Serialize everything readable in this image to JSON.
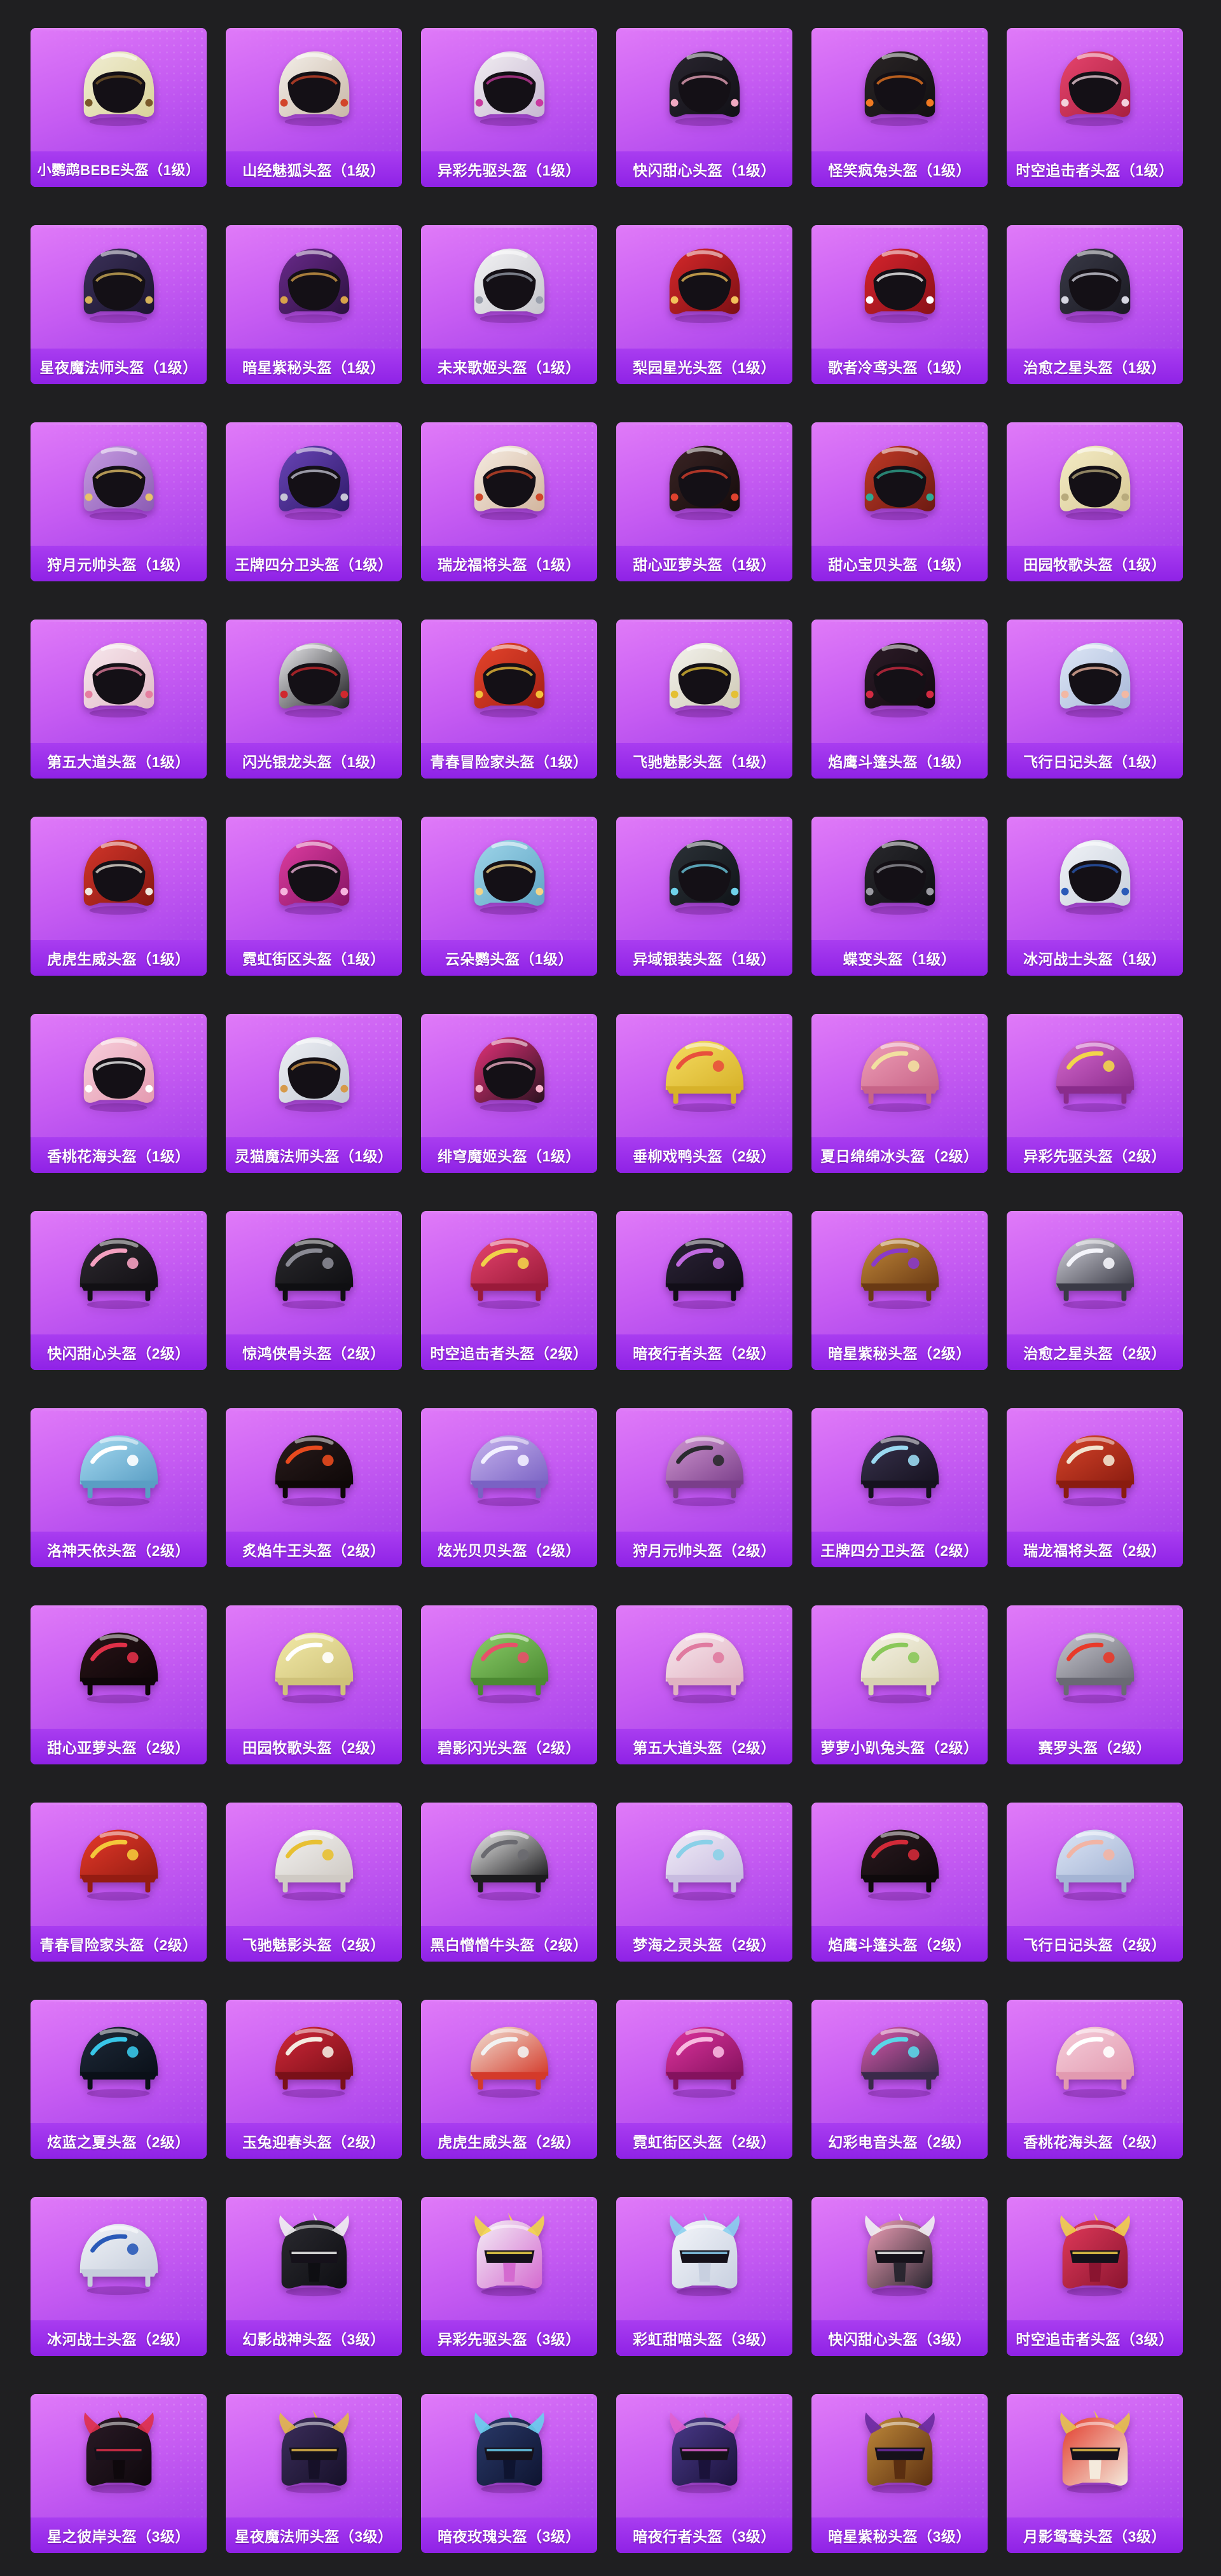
{
  "items": [
    {
      "label": "小鹦鹉BEBE头盔（1级）",
      "shape": "open",
      "c1": "#f1eed4",
      "c2": "#d9d39a",
      "accent": "#7a5a2a"
    },
    {
      "label": "山经魅狐头盔（1级）",
      "shape": "open",
      "c1": "#f4f0ea",
      "c2": "#c9b8a8",
      "accent": "#d2452a"
    },
    {
      "label": "异彩先驱头盔（1级）",
      "shape": "open",
      "c1": "#f2eef2",
      "c2": "#c7b8d2",
      "accent": "#c93aa0"
    },
    {
      "label": "快闪甜心头盔（1级）",
      "shape": "open",
      "c1": "#2a2630",
      "c2": "#111016",
      "accent": "#f0a8c0"
    },
    {
      "label": "怪笑疯兔头盔（1级）",
      "shape": "open",
      "c1": "#2a2526",
      "c2": "#121012",
      "accent": "#f07a22"
    },
    {
      "label": "时空追击者头盔（1级）",
      "shape": "open",
      "c1": "#e8456f",
      "c2": "#a8203f",
      "accent": "#f3d2dc"
    },
    {
      "label": "星夜魔法师头盔（1级）",
      "shape": "open",
      "c1": "#3b3159",
      "c2": "#1c1530",
      "accent": "#d4b15a"
    },
    {
      "label": "暗星紫秘头盔（1级）",
      "shape": "open",
      "c1": "#6a2a8c",
      "c2": "#2c1240",
      "accent": "#d8a24a"
    },
    {
      "label": "未来歌姬头盔（1级）",
      "shape": "open",
      "c1": "#f3f3f5",
      "c2": "#c6c6cc",
      "accent": "#9aa0ad"
    },
    {
      "label": "梨园星光头盔（1级）",
      "shape": "open",
      "c1": "#d6282a",
      "c2": "#7c1014",
      "accent": "#f2c15a"
    },
    {
      "label": "歌者冷鸢头盔（1级）",
      "shape": "open",
      "c1": "#d8242d",
      "c2": "#8a1118",
      "accent": "#ffffff"
    },
    {
      "label": "治愈之星头盔（1级）",
      "shape": "open",
      "c1": "#3a3a48",
      "c2": "#1a1a22",
      "accent": "#d6d6e2"
    },
    {
      "label": "狩月元帅头盔（1级）",
      "shape": "open",
      "c1": "#c79de2",
      "c2": "#8b5bb4",
      "accent": "#e7c36a"
    },
    {
      "label": "王牌四分卫头盔（1级）",
      "shape": "open",
      "c1": "#6a45b8",
      "c2": "#2f1b6a",
      "accent": "#c6c6d6"
    },
    {
      "label": "瑞龙福将头盔（1级）",
      "shape": "open",
      "c1": "#f6ede2",
      "c2": "#d2b59e",
      "accent": "#d0472a"
    },
    {
      "label": "甜心亚萝头盔（1级）",
      "shape": "open",
      "c1": "#3a2424",
      "c2": "#160c0c",
      "accent": "#e0422e"
    },
    {
      "label": "甜心宝贝头盔（1级）",
      "shape": "open",
      "c1": "#c23a26",
      "c2": "#6c1a12",
      "accent": "#2fa892"
    },
    {
      "label": "田园牧歌头盔（1级）",
      "shape": "open",
      "c1": "#f5edc6",
      "c2": "#d7c896",
      "accent": "#b8aa7c"
    },
    {
      "label": "第五大道头盔（1级）",
      "shape": "open",
      "c1": "#f8e9ee",
      "c2": "#e0b9c6",
      "accent": "#e57fa0"
    },
    {
      "label": "闪光银龙头盔（1级）",
      "shape": "open",
      "c1": "#f1f1f4",
      "c2": "#1e1e22",
      "accent": "#d0282e"
    },
    {
      "label": "青春冒险家头盔（1级）",
      "shape": "open",
      "c1": "#e7452c",
      "c2": "#a42014",
      "accent": "#f3c23a"
    },
    {
      "label": "飞驰魅影头盔（1级）",
      "shape": "open",
      "c1": "#f4f3ee",
      "c2": "#cfcab6",
      "accent": "#e4c034"
    },
    {
      "label": "焰鹰斗篷头盔（1级）",
      "shape": "open",
      "c1": "#2d1c28",
      "c2": "#120a10",
      "accent": "#d32a42"
    },
    {
      "label": "飞行日记头盔（1级）",
      "shape": "open",
      "c1": "#dfe8f7",
      "c2": "#a8b8d8",
      "accent": "#f2b8a4"
    },
    {
      "label": "虎虎生威头盔（1级）",
      "shape": "open",
      "c1": "#d4362a",
      "c2": "#861811",
      "accent": "#f0e8de"
    },
    {
      "label": "霓虹街区头盔（1级）",
      "shape": "open",
      "c1": "#e03ea2",
      "c2": "#861464",
      "accent": "#f6b4de"
    },
    {
      "label": "云朵鹦头盔（1级）",
      "shape": "open",
      "c1": "#9fd6ea",
      "c2": "#5fa4c4",
      "accent": "#f3d488"
    },
    {
      "label": "异域银装头盔（1级）",
      "shape": "open",
      "c1": "#2c3238",
      "c2": "#101418",
      "accent": "#6fd2ea"
    },
    {
      "label": "蝶变头盔（1级）",
      "shape": "open",
      "c1": "#2a2a2e",
      "c2": "#0e0e12",
      "accent": "#9a9aa2"
    },
    {
      "label": "冰河战士头盔（1级）",
      "shape": "open",
      "c1": "#f1f3f7",
      "c2": "#c8d0dc",
      "accent": "#2a5ab8"
    },
    {
      "label": "香桃花海头盔（1级）",
      "shape": "open",
      "c1": "#f8d0dc",
      "c2": "#e49ab0",
      "accent": "#ffffff"
    },
    {
      "label": "灵猫魔法师头盔（1级）",
      "shape": "open",
      "c1": "#eef0f4",
      "c2": "#c2c8d4",
      "accent": "#d69a4a"
    },
    {
      "label": "绯穹魔姬头盔（1级）",
      "shape": "open",
      "c1": "#e6327a",
      "c2": "#2a1220",
      "accent": "#f7b4cc"
    },
    {
      "label": "垂柳戏鸭头盔（2级）",
      "shape": "cap",
      "c1": "#f6dd62",
      "c2": "#d7b22a",
      "accent": "#e8503c"
    },
    {
      "label": "夏日绵绵冰头盔（2级）",
      "shape": "cap",
      "c1": "#f0a0b8",
      "c2": "#c76488",
      "accent": "#f2e0a0"
    },
    {
      "label": "异彩先驱头盔（2级）",
      "shape": "cap",
      "c1": "#d86ad0",
      "c2": "#8a2c8c",
      "accent": "#f2d64a"
    },
    {
      "label": "快闪甜心头盔（2级）",
      "shape": "cap",
      "c1": "#2e2a30",
      "c2": "#121014",
      "accent": "#f4a0c0"
    },
    {
      "label": "惊鸿侠骨头盔（2级）",
      "shape": "cap",
      "c1": "#2b2a2e",
      "c2": "#0f0f12",
      "accent": "#8a8a94"
    },
    {
      "label": "时空追击者头盔（2级）",
      "shape": "cap",
      "c1": "#e8456f",
      "c2": "#9a1a3a",
      "accent": "#f2d04a"
    },
    {
      "label": "暗夜行者头盔（2级）",
      "shape": "cap",
      "c1": "#2c2438",
      "c2": "#120e18",
      "accent": "#c06ae0"
    },
    {
      "label": "暗星紫秘头盔（2级）",
      "shape": "cap",
      "c1": "#c48a3a",
      "c2": "#6a3a14",
      "accent": "#8a3ac8"
    },
    {
      "label": "治愈之星头盔（2级）",
      "shape": "cap",
      "c1": "#d6d6de",
      "c2": "#3a3a46",
      "accent": "#f4f4fa"
    },
    {
      "label": "洛神天依头盔（2级）",
      "shape": "cap",
      "c1": "#a8dcf2",
      "c2": "#5a9ec4",
      "accent": "#ffffff"
    },
    {
      "label": "炙焰牛王头盔（2级）",
      "shape": "cap",
      "c1": "#2a1c1c",
      "c2": "#0e0808",
      "accent": "#e84a1e"
    },
    {
      "label": "炫光贝贝头盔（2级）",
      "shape": "cap",
      "c1": "#c8b6ee",
      "c2": "#7a62c4",
      "accent": "#f2f0ff"
    },
    {
      "label": "狩月元帅头盔（2级）",
      "shape": "cap",
      "c1": "#d29ad2",
      "c2": "#7a3e8a",
      "accent": "#2a2a2e"
    },
    {
      "label": "王牌四分卫头盔（2级）",
      "shape": "cap",
      "c1": "#3a3450",
      "c2": "#16121f",
      "accent": "#9ad8f0"
    },
    {
      "label": "瑞龙福将头盔（2级）",
      "shape": "cap",
      "c1": "#d8452a",
      "c2": "#8a1c10",
      "accent": "#f2e4d0"
    },
    {
      "label": "甜心亚萝头盔（2级）",
      "shape": "cap",
      "c1": "#2a1418",
      "c2": "#0e0608",
      "accent": "#e03048"
    },
    {
      "label": "田园牧歌头盔（2级）",
      "shape": "cap",
      "c1": "#f2eaa8",
      "c2": "#cfc27a",
      "accent": "#ffffff"
    },
    {
      "label": "碧影闪光头盔（2级）",
      "shape": "cap",
      "c1": "#8ccf6a",
      "c2": "#4c8a32",
      "accent": "#e8506a"
    },
    {
      "label": "第五大道头盔（2级）",
      "shape": "cap",
      "c1": "#f8e8ee",
      "c2": "#e0b2c2",
      "accent": "#e07aa0"
    },
    {
      "label": "萝萝小趴兔头盔（2级）",
      "shape": "cap",
      "c1": "#f6f4e6",
      "c2": "#d8d2b2",
      "accent": "#8ac85a"
    },
    {
      "label": "赛罗头盔（2级）",
      "shape": "cap",
      "c1": "#c8c8d0",
      "c2": "#6a6a74",
      "accent": "#e83a2a"
    },
    {
      "label": "青春冒险家头盔（2级）",
      "shape": "cap",
      "c1": "#e83a2a",
      "c2": "#941c12",
      "accent": "#f4c83a"
    },
    {
      "label": "飞驰魅影头盔（2级）",
      "shape": "cap",
      "c1": "#f4f3f2",
      "c2": "#cfcac4",
      "accent": "#e8c032"
    },
    {
      "label": "黑白憎憎牛头盔（2级）",
      "shape": "cap",
      "c1": "#f2f2f2",
      "c2": "#1c1c1e",
      "accent": "#6a6a70"
    },
    {
      "label": "梦海之灵头盔（2级）",
      "shape": "cap",
      "c1": "#f2eef8",
      "c2": "#c8bce0",
      "accent": "#8ad0e8"
    },
    {
      "label": "焰鹰斗篷头盔（2级）",
      "shape": "cap",
      "c1": "#2c1a20",
      "c2": "#0f0a0c",
      "accent": "#d22a38"
    },
    {
      "label": "飞行日记头盔（2级）",
      "shape": "cap",
      "c1": "#dde6f6",
      "c2": "#a4b4d4",
      "accent": "#f2b4a4"
    },
    {
      "label": "炫蓝之夏头盔（2级）",
      "shape": "cap",
      "c1": "#1e2a3a",
      "c2": "#0a1018",
      "accent": "#38c6e8"
    },
    {
      "label": "玉兔迎春头盔（2级）",
      "shape": "cap",
      "c1": "#d4283a",
      "c2": "#7a1018",
      "accent": "#f4eae0"
    },
    {
      "label": "虎虎生威头盔（2级）",
      "shape": "cap",
      "c1": "#f2e6da",
      "c2": "#d43a2a",
      "accent": "#f2f2f2"
    },
    {
      "label": "霓虹街区头盔（2级）",
      "shape": "cap",
      "c1": "#e234a0",
      "c2": "#84125e",
      "accent": "#f8b8e0"
    },
    {
      "label": "幻彩电音头盔（2级）",
      "shape": "cap",
      "c1": "#e05ab0",
      "c2": "#3a2a4a",
      "accent": "#5ad6e8"
    },
    {
      "label": "香桃花海头盔（2级）",
      "shape": "cap",
      "c1": "#f6d0dc",
      "c2": "#e29ab0",
      "accent": "#ffffff"
    },
    {
      "label": "冰河战士头盔（2级）",
      "shape": "cap",
      "c1": "#f2f4f8",
      "c2": "#c6cedc",
      "accent": "#2a5ab8"
    },
    {
      "label": "幻影战神头盔（3级）",
      "shape": "spartan",
      "c1": "#2a2a30",
      "c2": "#0e0e12",
      "accent": "#f2f2f2"
    },
    {
      "label": "异彩先驱头盔（3级）",
      "shape": "spartan",
      "c1": "#f4f0f6",
      "c2": "#d46ad0",
      "accent": "#f2d64a"
    },
    {
      "label": "彩虹甜喵头盔（3级）",
      "shape": "spartan",
      "c1": "#f4f6fa",
      "c2": "#c8d0e0",
      "accent": "#8ad0f0"
    },
    {
      "label": "快闪甜心头盔（3级）",
      "shape": "spartan",
      "c1": "#f0a0b8",
      "c2": "#2a2630",
      "accent": "#f2f2f2"
    },
    {
      "label": "时空追击者头盔（3级）",
      "shape": "spartan",
      "c1": "#e23a5a",
      "c2": "#8a1430",
      "accent": "#f2d04a"
    },
    {
      "label": "星之彼岸头盔（3级）",
      "shape": "spartan",
      "c1": "#2a1a26",
      "c2": "#0e080c",
      "accent": "#e0304a"
    },
    {
      "label": "星夜魔法师头盔（3级）",
      "shape": "spartan",
      "c1": "#3c2e5c",
      "c2": "#161028",
      "accent": "#e2b84a"
    },
    {
      "label": "暗夜玫瑰头盔（3级）",
      "shape": "spartan",
      "c1": "#2a3a6a",
      "c2": "#0e1430",
      "accent": "#6ad0f0"
    },
    {
      "label": "暗夜行者头盔（3级）",
      "shape": "spartan",
      "c1": "#4a3a8a",
      "c2": "#1a123a",
      "accent": "#e060d0"
    },
    {
      "label": "暗星紫秘头盔（3级）",
      "shape": "spartan",
      "c1": "#c08a3a",
      "c2": "#5a2e10",
      "accent": "#6a2aa0"
    },
    {
      "label": "月影鸳鸯头盔（3级）",
      "shape": "spartan",
      "c1": "#e23a2a",
      "c2": "#f4eadc",
      "accent": "#e8c24a"
    }
  ]
}
